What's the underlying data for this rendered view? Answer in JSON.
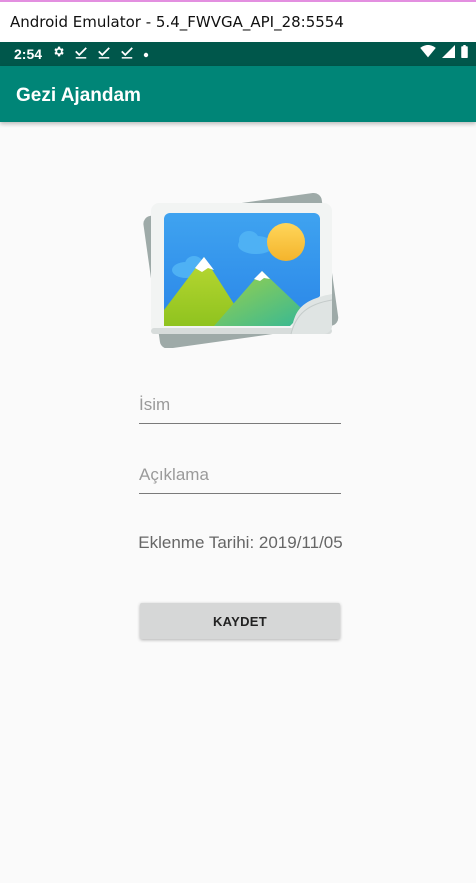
{
  "window": {
    "title": "Android Emulator - 5.4_FWVGA_API_28:5554"
  },
  "status_bar": {
    "time": "2:54",
    "left_icons": [
      "gear-icon",
      "check-icon",
      "check-icon",
      "check-icon",
      "dot-icon"
    ],
    "right_icons": [
      "wifi-icon",
      "signal-icon",
      "battery-icon"
    ],
    "background": "#00574b"
  },
  "app_bar": {
    "title": "Gezi Ajandam",
    "background": "#008577"
  },
  "form": {
    "image_placeholder_icon": "image-placeholder-icon",
    "name_placeholder": "İsim",
    "name_value": "",
    "description_placeholder": "Açıklama",
    "description_value": "",
    "date_label": "Eklenme Tarihi: 2019/11/05",
    "save_label": "KAYDET"
  }
}
